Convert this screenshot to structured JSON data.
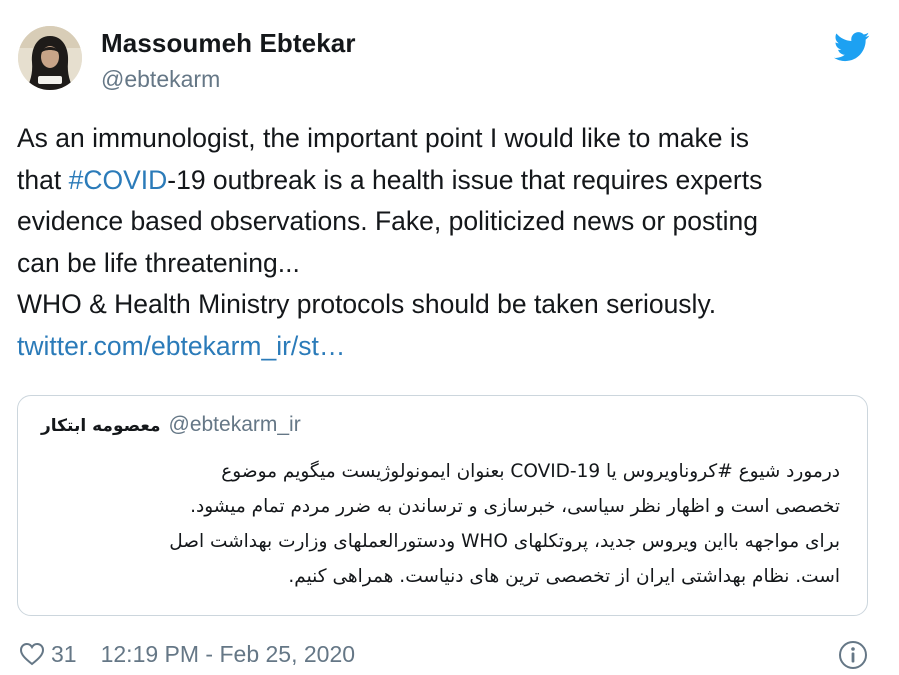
{
  "author": {
    "display_name": "Massoumeh Ebtekar",
    "handle": "@ebtekarm",
    "avatar_icon": "profile-photo"
  },
  "brand": {
    "icon": "twitter-bird-icon",
    "color": "#1da1f2"
  },
  "tweet": {
    "line1": "As an immunologist, the important point I would like to make is",
    "line2_prefix": "that ",
    "line2_hashtag": "#COVID",
    "line2_suffix": "-19 outbreak is a health issue that requires experts",
    "line3": "evidence based  observations. Fake, politicized news or posting",
    "line4": "can be life threatening...",
    "line5": "WHO & Health Ministry protocols should be taken seriously.",
    "link": "twitter.com/ebtekarm_ir/st…",
    "link_color": "#2b7bb9"
  },
  "quoted_tweet": {
    "display_name": "معصومه ابتکار",
    "handle": "@ebtekarm_ir",
    "lines": [
      "درمورد شیوع #کروناویروس یا COVID-19 بعنوان ایمونولوژیست میگویم موضوع",
      "تخصصی است و اظهار نظر سیاسی، خبرسازی و ترساندن به ضرر مردم تمام میشود.",
      "برای مواجهه بااین ویروس جدید، پروتکلهای WHO ودستورالعملهای وزارت بهداشت اصل",
      "است. نظام بهداشتی ایران از تخصصی ترین های دنیاست. همراهی کنیم."
    ]
  },
  "footer": {
    "like_icon": "heart-icon",
    "like_count": "31",
    "timestamp": "12:19 PM - Feb 25, 2020",
    "info_icon": "info-icon"
  }
}
